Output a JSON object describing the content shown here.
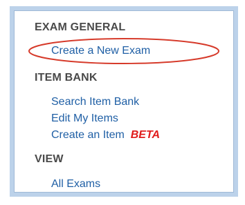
{
  "nav": {
    "sections": [
      {
        "heading": "EXAM GENERAL",
        "items": [
          "Create a New Exam"
        ]
      },
      {
        "heading": "ITEM BANK",
        "items": [
          "Search Item Bank",
          "Edit My Items",
          "Create an Item"
        ],
        "badge": "BETA"
      },
      {
        "heading": "VIEW",
        "items": [
          "All Exams"
        ]
      }
    ]
  },
  "colors": {
    "panel_border": "#bcd2ea",
    "heading_text": "#4a4a4a",
    "link_text": "#1f5fa5",
    "beta_badge": "#e01b1b",
    "highlight_ellipse": "#d63a2a"
  },
  "annotations": {
    "highlighted_item": "Create a New Exam",
    "highlight_shape": "red-ellipse"
  }
}
